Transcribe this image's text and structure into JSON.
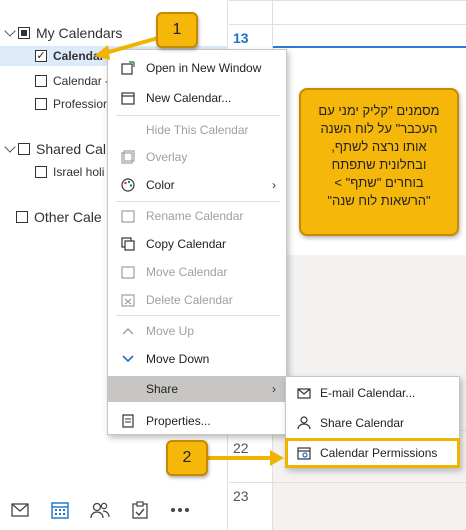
{
  "nav": {
    "my_calendars_label": "My Calendars",
    "calendar_label": "Calendar",
    "calendar2_label": "Calendar -",
    "profession_label": "Professior",
    "shared_label": "Shared Cal",
    "israel_label": "Israel holi",
    "other_label": "Other Cale"
  },
  "grid": {
    "day_13": "13",
    "day_22": "22",
    "day_23": "23"
  },
  "menu": {
    "open_new_window": "Open in New Window",
    "new_calendar": "New Calendar...",
    "hide_calendar": "Hide This Calendar",
    "overlay": "Overlay",
    "color": "Color",
    "rename_calendar": "Rename Calendar",
    "copy_calendar": "Copy Calendar",
    "move_calendar": "Move Calendar",
    "delete_calendar": "Delete Calendar",
    "move_up": "Move Up",
    "move_down": "Move Down",
    "share": "Share",
    "properties": "Properties..."
  },
  "submenu": {
    "email_calendar": "E-mail Calendar...",
    "share_calendar": "Share Calendar",
    "calendar_permissions": "Calendar Permissions"
  },
  "callouts": {
    "badge_1": "1",
    "badge_2": "2",
    "note_text": "מסמנים \"קליק ימני עם העכבר\" על לוח השנה אותו נרצה לשתף, ובחלונית שתפתח בוחרים \"שתף\" > \"הרשאות לוח שנה\""
  },
  "colors": {
    "accent": "#1a73c9",
    "callout": "#f5b70a",
    "selected_row": "#dceaf9"
  }
}
